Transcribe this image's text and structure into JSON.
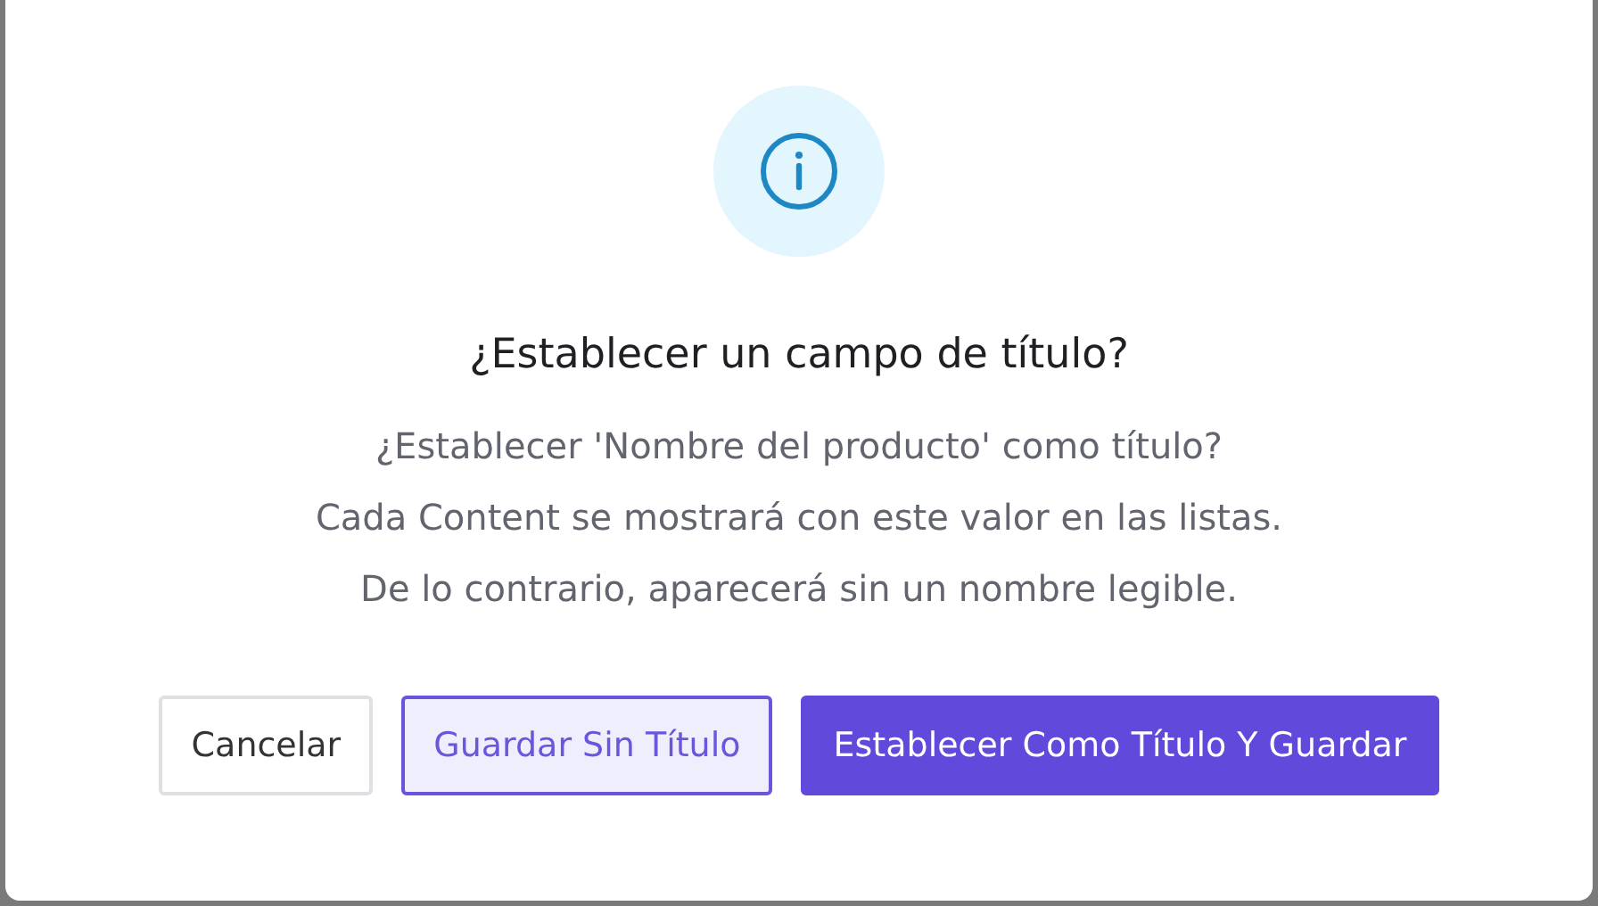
{
  "dialog": {
    "title": "¿Establecer un campo de título?",
    "message": [
      "¿Establecer 'Nombre del producto' como título?",
      "Cada Content se mostrará con este valor en las listas.",
      "De lo contrario, aparecerá sin un nombre legible."
    ],
    "buttons": [
      {
        "label": "Cancelar",
        "kind": "default"
      },
      {
        "label": "Guardar Sin Título",
        "kind": "secondary"
      },
      {
        "label": "Establecer Como Título Y Guardar",
        "kind": "primary"
      }
    ]
  }
}
